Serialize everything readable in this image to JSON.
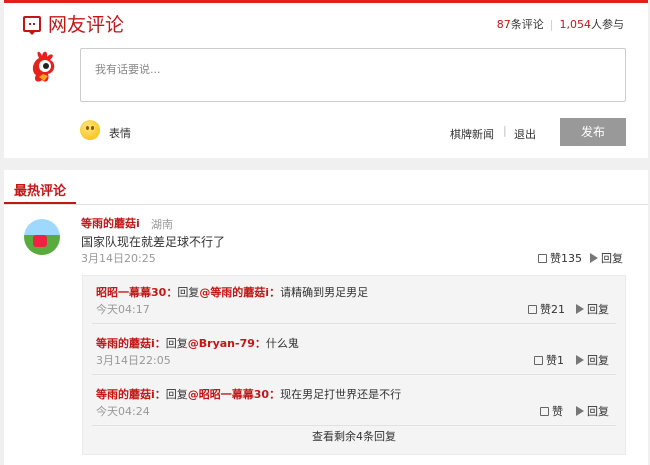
{
  "header": {
    "title": "网友评论",
    "comment_count": "87",
    "comment_unit": "条评论",
    "participant_count": "1,054",
    "participant_unit": "人参与"
  },
  "composer": {
    "placeholder": "我有话要说...",
    "emoji_label": "表情",
    "site_link": "棋牌新闻",
    "separator": "|",
    "logout_label": "退出",
    "publish_label": "发布"
  },
  "hot": {
    "title": "最热评论",
    "comment": {
      "user": "等雨的蘑菇i",
      "location": "湖南",
      "text": "国家队现在就差足球不行了",
      "time": "3月14日20:25",
      "like_label": "赞",
      "likes": "135",
      "reply_label": "回复"
    },
    "replies": [
      {
        "from": "昭昭一幕幕30",
        "action": "回复",
        "to": "@等雨的蘑菇i",
        "text": "请精确到男足男足",
        "time": "今天04:17",
        "likes": "21"
      },
      {
        "from": "等雨的蘑菇i",
        "action": "回复",
        "to": "@Bryan-79",
        "text": "什么鬼",
        "time": "3月14日22:05",
        "likes": "1"
      },
      {
        "from": "等雨的蘑菇i",
        "action": "回复",
        "to": "@昭昭一幕幕30",
        "text": "现在男足打世界还是不行",
        "time": "今天04:24",
        "likes": ""
      }
    ],
    "more_label": "查看剩余4条回复"
  },
  "colors": {
    "accent": "#c21717",
    "top_border": "#e21e1e",
    "button": "#999999"
  }
}
